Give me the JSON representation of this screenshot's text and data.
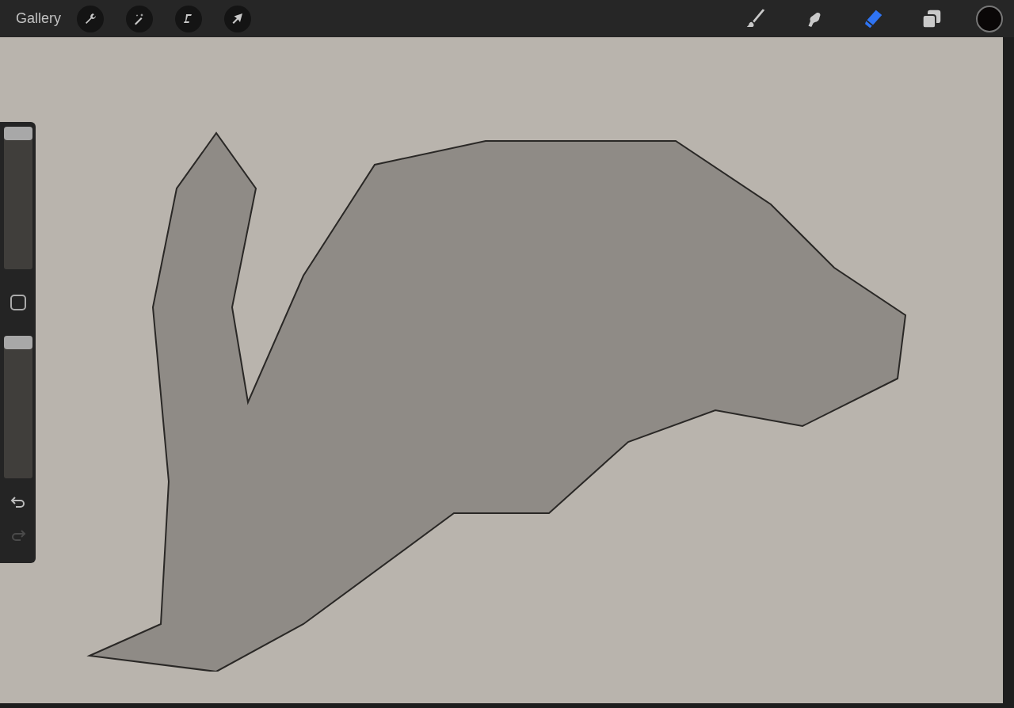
{
  "top_bar": {
    "gallery": "Gallery",
    "left_tools": [
      {
        "kind": "wrench"
      },
      {
        "kind": "wand"
      },
      {
        "kind": "selection"
      },
      {
        "kind": "transform"
      }
    ],
    "right_tools": [
      {
        "kind": "brush",
        "selected": false
      },
      {
        "kind": "smudge",
        "selected": false
      },
      {
        "kind": "eraser",
        "selected": true
      },
      {
        "kind": "layers",
        "selected": false
      }
    ],
    "color": "#0a0707"
  },
  "sidebar": {
    "size_slider": {
      "level": 1
    },
    "opacity_slider": {
      "level": 1
    },
    "undo": {
      "disabled": false
    },
    "redo": {
      "disabled": true
    }
  }
}
